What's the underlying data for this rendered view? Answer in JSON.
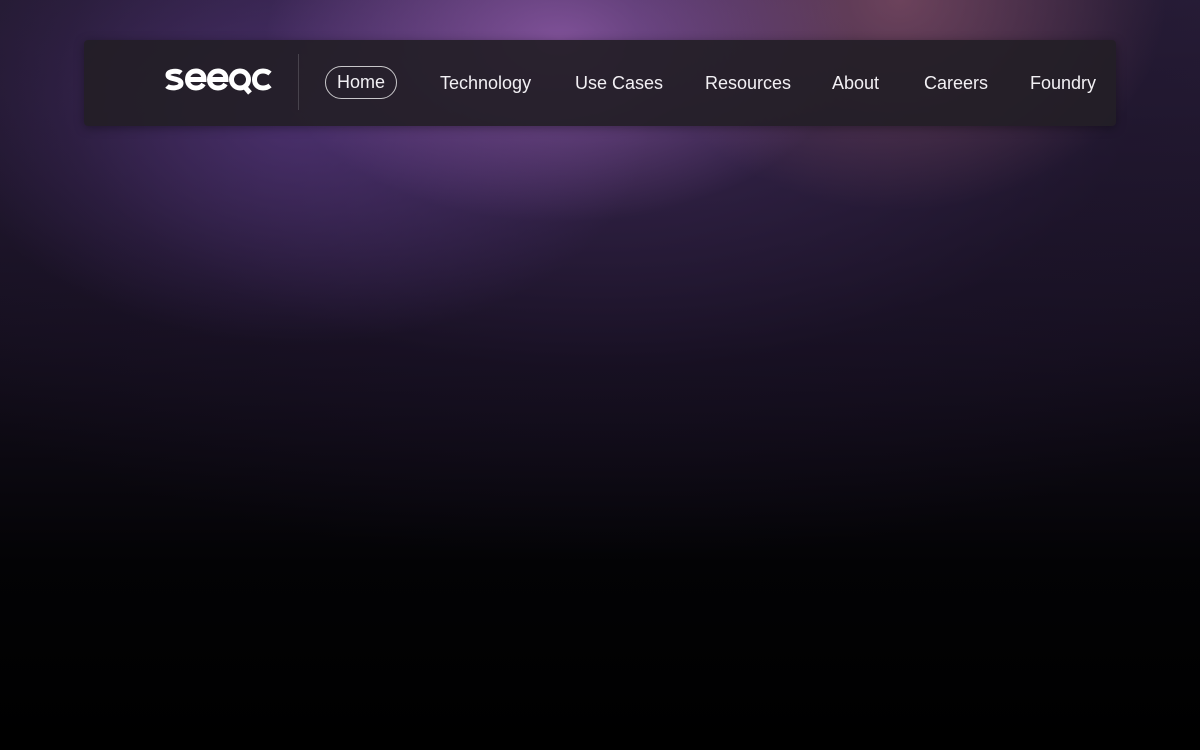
{
  "brand": {
    "name": "seeqc"
  },
  "nav": {
    "items": [
      {
        "label": "Home",
        "active": true
      },
      {
        "label": "Technology"
      },
      {
        "label": "Use Cases"
      },
      {
        "label": "Resources"
      },
      {
        "label": "About"
      },
      {
        "label": "Careers"
      },
      {
        "label": "Foundry"
      }
    ]
  }
}
